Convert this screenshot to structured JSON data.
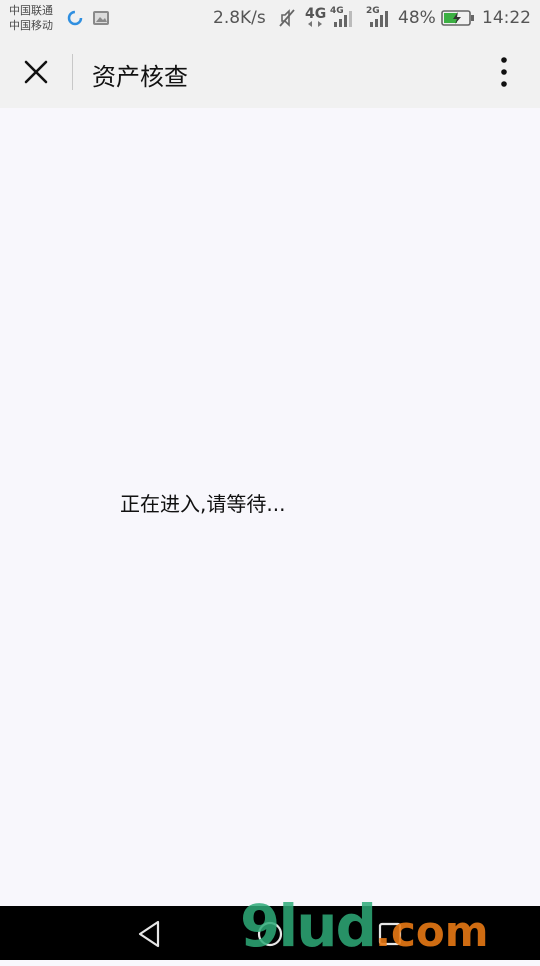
{
  "status_bar": {
    "carrier_1": "中国联通",
    "carrier_2": "中国移动",
    "network_speed": "2.8K/s",
    "signal_1_label": "4G",
    "signal_2_label": "4G",
    "signal_3_label": "2G",
    "battery_percent": "48%",
    "time": "14:22",
    "icons": [
      "browser-ring-icon",
      "gallery-icon",
      "mute-icon",
      "data-arrows-icon",
      "signal-bars-icon",
      "battery-charging-icon"
    ]
  },
  "title_bar": {
    "title": "资产核查",
    "icons": [
      "close-icon",
      "more-vertical-icon"
    ]
  },
  "main": {
    "loading_text": "正在进入,请等待..."
  },
  "nav_bar": {
    "icons": [
      "back-triangle-icon",
      "home-circle-icon",
      "recents-square-icon"
    ]
  },
  "watermark": {
    "brand": "9lud",
    "suffix": ".com"
  },
  "colors": {
    "status_bar_bg": "#f1f1f1",
    "content_bg": "#f8f7fc",
    "nav_bar_bg": "#000000",
    "battery_green": "#3cb043"
  }
}
